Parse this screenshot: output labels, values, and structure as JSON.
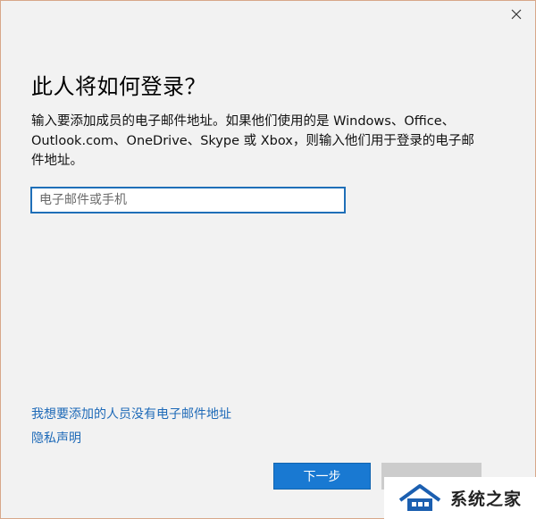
{
  "dialog": {
    "heading": "此人将如何登录？",
    "description": "输入要添加成员的电子邮件地址。如果他们使用的是 Windows、Office、Outlook.com、OneDrive、Skype 或 Xbox，则输入他们用于登录的电子邮件地址。",
    "email_input": {
      "placeholder": "电子邮件或手机",
      "value": ""
    },
    "links": {
      "no_email": "我想要添加的人员没有电子邮件地址",
      "privacy": "隐私声明"
    },
    "buttons": {
      "next": "下一步",
      "cancel": ""
    }
  },
  "watermark": {
    "text": "系统之家"
  },
  "colors": {
    "accent": "#1979d2",
    "link": "#1e6ab8",
    "background": "#f2f2f2",
    "window_border": "#d8a78a"
  },
  "icons": {
    "close": "close-icon",
    "watermark_logo": "house-logo-icon"
  }
}
